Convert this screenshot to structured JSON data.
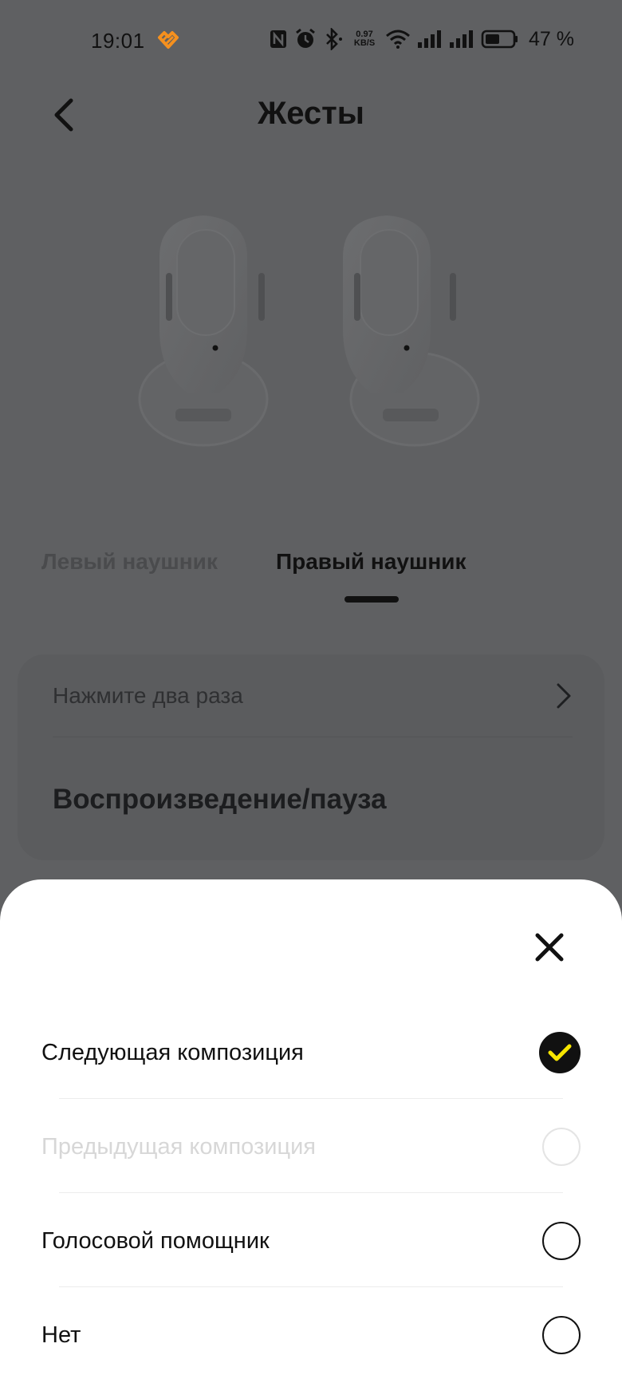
{
  "status_bar": {
    "time": "19:01",
    "app_icon": "heart-app-icon",
    "network_speed_value": "0.97",
    "network_speed_unit": "KB/S",
    "battery_percent": "47 %",
    "icons": [
      "nfc-icon",
      "alarm-icon",
      "bluetooth-icon",
      "wifi-icon",
      "signal-icon",
      "signal-icon",
      "battery-icon"
    ],
    "accent_color": "#f5901e"
  },
  "header": {
    "title": "Жесты",
    "back_icon": "chevron-left-icon"
  },
  "tabs": {
    "left": "Левый наушник",
    "right": "Правый наушник",
    "selected": "right"
  },
  "gesture_card": {
    "label": "Нажмите два раза",
    "value": "Воспроизведение/пауза",
    "chevron_icon": "chevron-right-icon"
  },
  "sheet": {
    "close_icon": "close-icon",
    "options": [
      {
        "label": "Следующая композиция",
        "state": "selected"
      },
      {
        "label": "Предыдущая композиция",
        "state": "disabled"
      },
      {
        "label": "Голосовой помощник",
        "state": "unselected"
      },
      {
        "label": "Нет",
        "state": "unselected"
      }
    ],
    "check_color": "#f7e600"
  }
}
